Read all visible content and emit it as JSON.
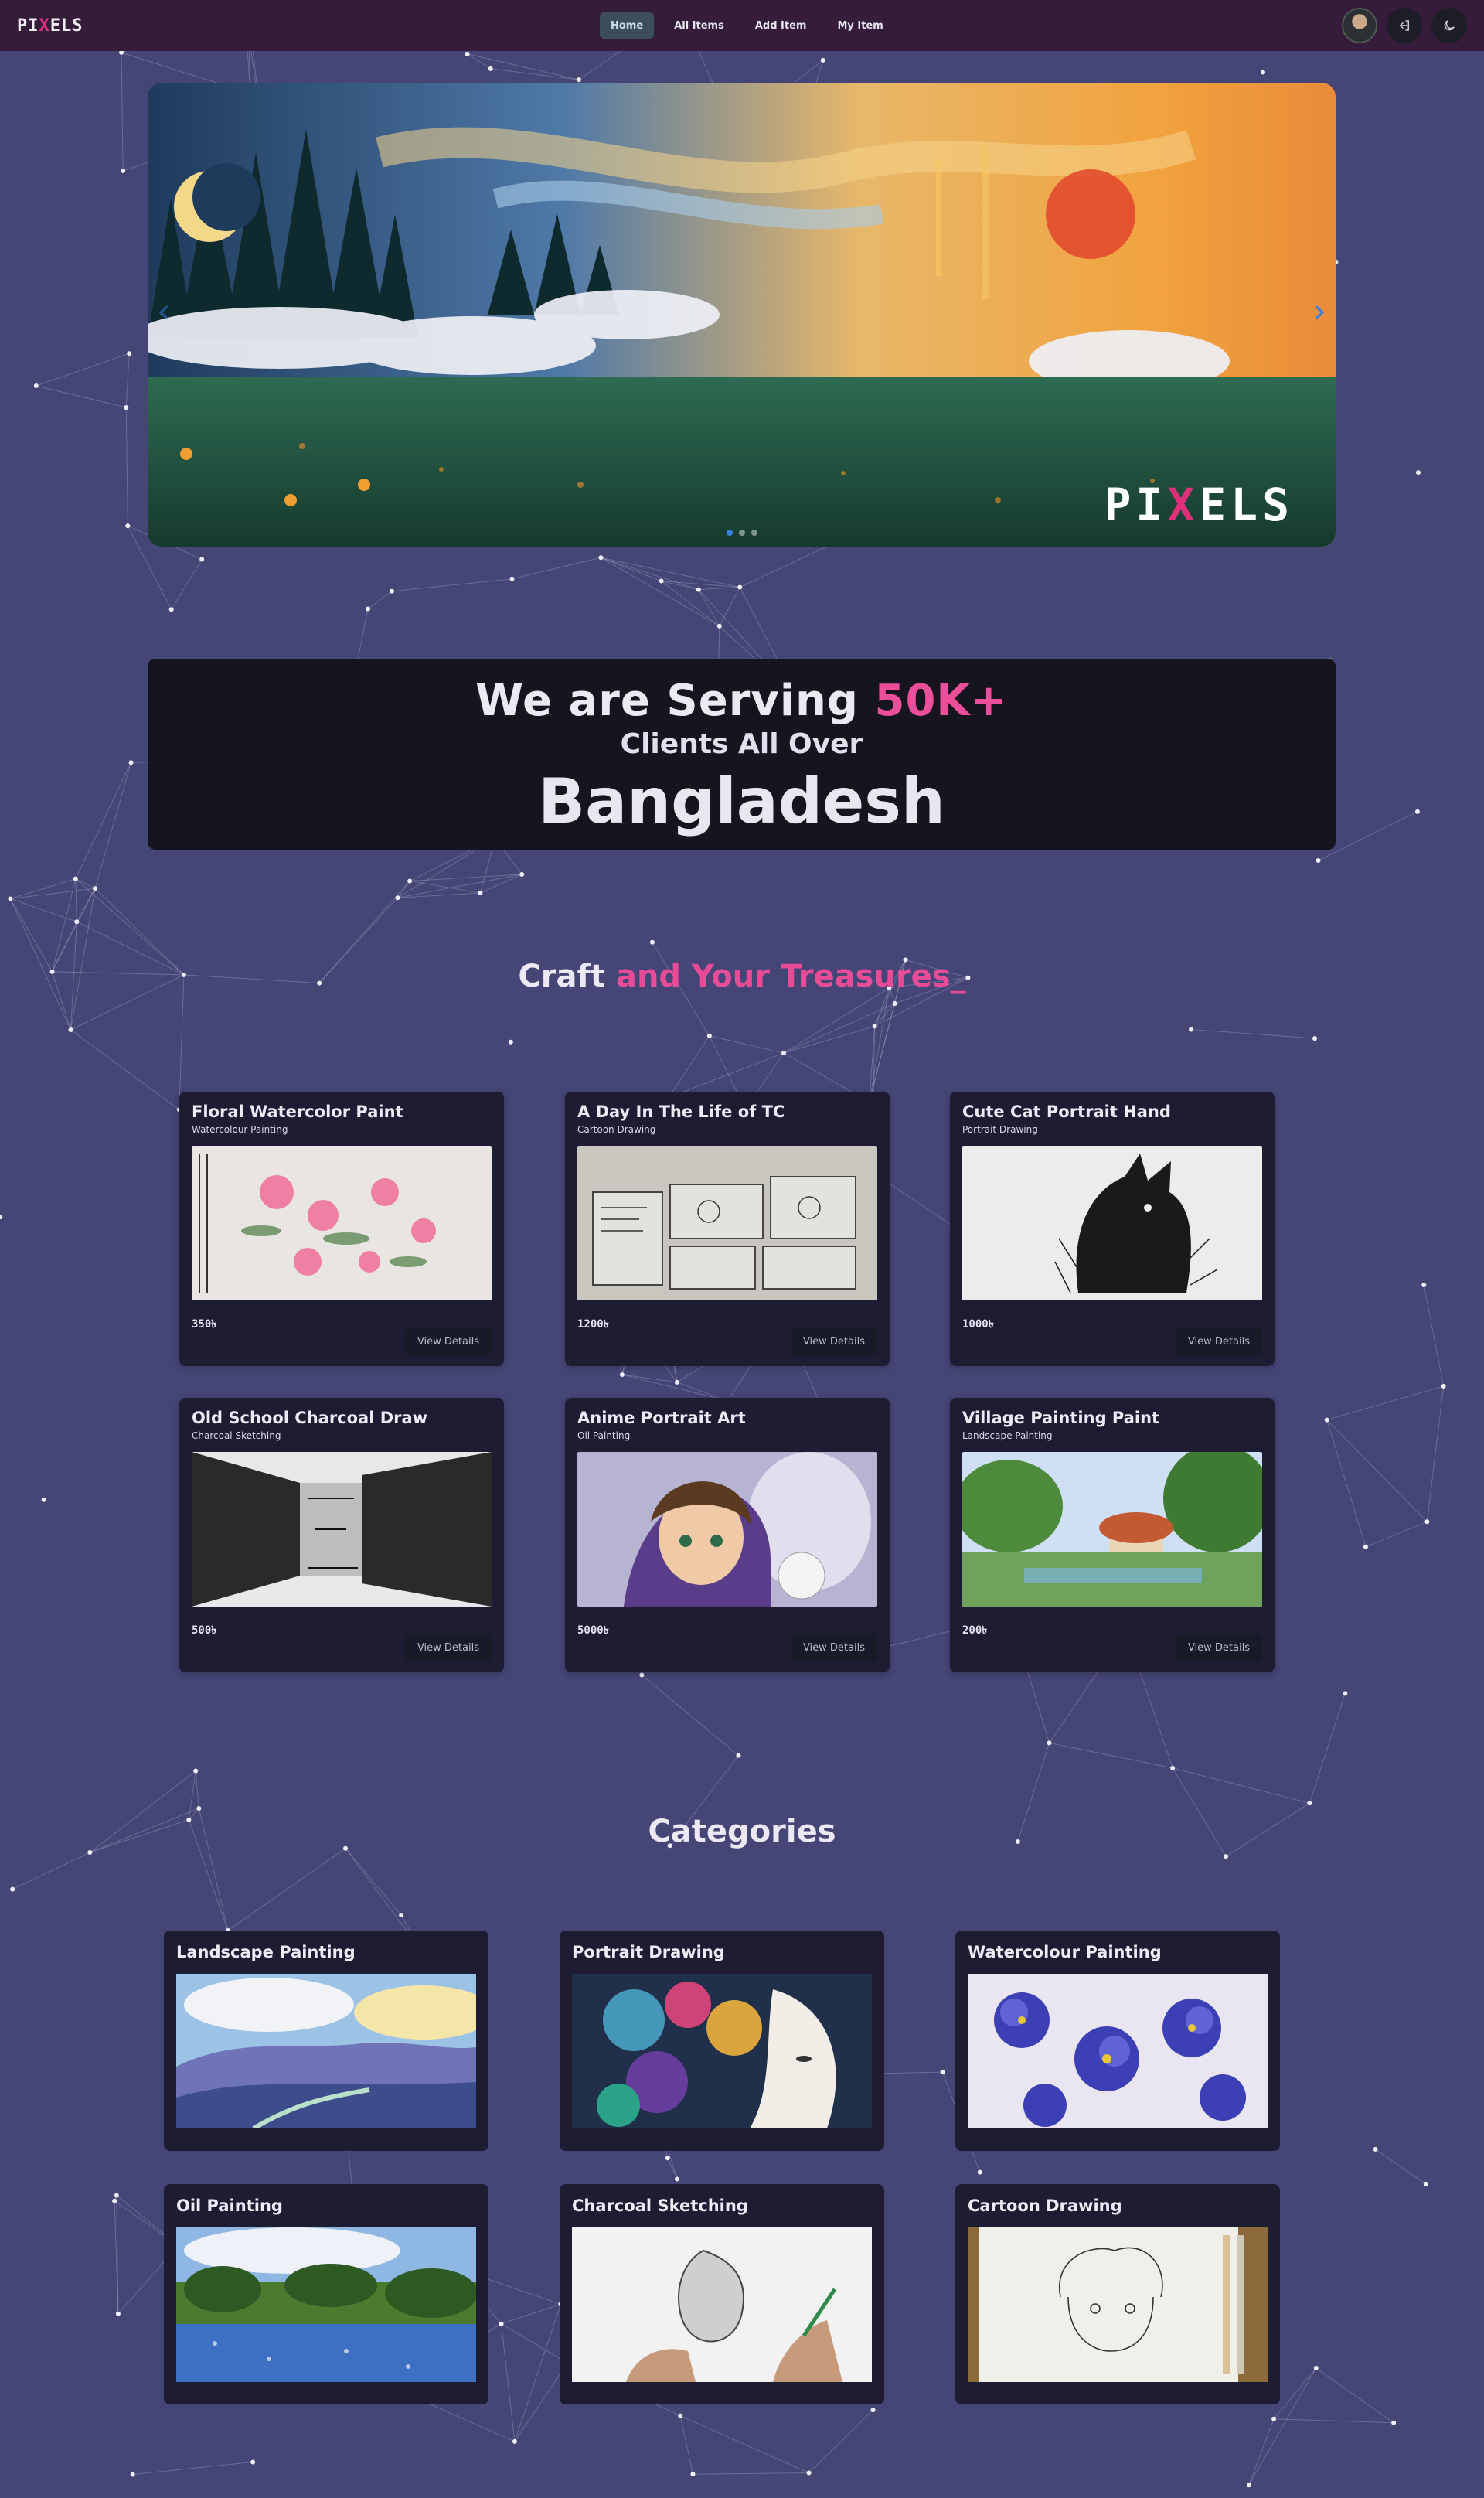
{
  "navbar": {
    "logo_prefix": "PI",
    "logo_x": "X",
    "logo_suffix": "ELS",
    "links": [
      {
        "label": "Home",
        "active": true
      },
      {
        "label": "All Items",
        "active": false
      },
      {
        "label": "Add Item",
        "active": false
      },
      {
        "label": "My Item",
        "active": false
      }
    ],
    "icons": [
      "avatar",
      "logout-icon",
      "moon-icon"
    ]
  },
  "hero": {
    "brand_prefix": "PI",
    "brand_x": "X",
    "brand_suffix": "ELS",
    "prev_arrow": "‹",
    "next_arrow": "›",
    "slide_count": 3,
    "active_slide": 1
  },
  "stats": {
    "line1_prefix": "We are Serving ",
    "line1_accent": "50K+",
    "line2": "Clients All Over",
    "line3": "Bangladesh"
  },
  "craft": {
    "title_prefix": "Craft",
    "title_accent": " and Your Treasures",
    "cursor": "_"
  },
  "items": [
    {
      "title": "Floral Watercolor Paint",
      "category": "Watercolour Painting",
      "price": "350৳",
      "button": "View Details",
      "image": "floral-watercolor"
    },
    {
      "title": "A Day In The Life of TC",
      "category": "Cartoon Drawing",
      "price": "1200৳",
      "button": "View Details",
      "image": "comic-sketch"
    },
    {
      "title": "Cute Cat Portrait Hand",
      "category": "Portrait Drawing",
      "price": "1000৳",
      "button": "View Details",
      "image": "cat-portrait"
    },
    {
      "title": "Old School Charcoal Draw",
      "category": "Charcoal Sketching",
      "price": "500৳",
      "button": "View Details",
      "image": "charcoal-corridor"
    },
    {
      "title": "Anime Portrait Art",
      "category": "Oil Painting",
      "price": "5000৳",
      "button": "View Details",
      "image": "anime-portrait"
    },
    {
      "title": "Village Painting Paint",
      "category": "Landscape Painting",
      "price": "200৳",
      "button": "View Details",
      "image": "village-painting"
    }
  ],
  "categories_section": {
    "title": "Categories",
    "items": [
      {
        "title": "Landscape Painting",
        "image": "landscape"
      },
      {
        "title": "Portrait Drawing",
        "image": "portrait"
      },
      {
        "title": "Watercolour Painting",
        "image": "watercolour-flowers"
      },
      {
        "title": "Oil Painting",
        "image": "oil-meadow"
      },
      {
        "title": "Charcoal Sketching",
        "image": "charcoal-hands"
      },
      {
        "title": "Cartoon Drawing",
        "image": "cartoon-boy"
      }
    ]
  },
  "colors": {
    "background": "#454576",
    "navbar": "#341c3a",
    "card": "#1d1c33",
    "accent_pink": "#ec4f9a",
    "accent_blue": "#3a7ee0"
  }
}
